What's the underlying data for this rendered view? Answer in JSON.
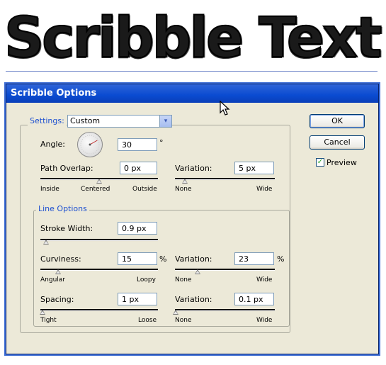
{
  "banner": {
    "text": "Scribble Text"
  },
  "dialog": {
    "title": "Scribble Options",
    "settings": {
      "legend": "Settings:",
      "selected": "Custom",
      "arrow_glyph": "▾"
    },
    "angle": {
      "label": "Angle:",
      "value": "30",
      "unit": "°",
      "dial_degrees": 30
    },
    "path_overlap": {
      "label": "Path Overlap:",
      "value": "0 px",
      "slider": {
        "level": 0.5,
        "min_label": "Inside",
        "mid_label": "Centered",
        "max_label": "Outside"
      }
    },
    "overlap_variation": {
      "label": "Variation:",
      "value": "5 px",
      "slider": {
        "level": 0.1,
        "min_label": "None",
        "max_label": "Wide"
      }
    },
    "line_options": {
      "legend": "Line Options"
    },
    "stroke_width": {
      "label": "Stroke Width:",
      "value": "0.9 px",
      "slider": {
        "level": 0.05
      }
    },
    "curviness": {
      "label": "Curviness:",
      "value": "15",
      "unit": "%",
      "slider": {
        "level": 0.15,
        "min_label": "Angular",
        "max_label": "Loopy"
      }
    },
    "curviness_variation": {
      "label": "Variation:",
      "value": "23",
      "unit": "%",
      "slider": {
        "level": 0.23,
        "min_label": "None",
        "max_label": "Wide"
      }
    },
    "spacing": {
      "label": "Spacing:",
      "value": "1 px",
      "slider": {
        "level": 0.02,
        "min_label": "Tight",
        "max_label": "Loose"
      }
    },
    "spacing_variation": {
      "label": "Variation:",
      "value": "0.1 px",
      "slider": {
        "level": 0.01,
        "min_label": "None",
        "max_label": "Wide"
      }
    },
    "buttons": {
      "ok": "OK",
      "cancel": "Cancel"
    },
    "preview": {
      "label": "Preview",
      "checked": true,
      "check_glyph": "✓"
    }
  },
  "colors": {
    "title_bar": "#0a4bd1",
    "dialog_bg": "#ece9d8",
    "legend_text": "#1c4fd0",
    "field_border": "#7f9db9"
  }
}
